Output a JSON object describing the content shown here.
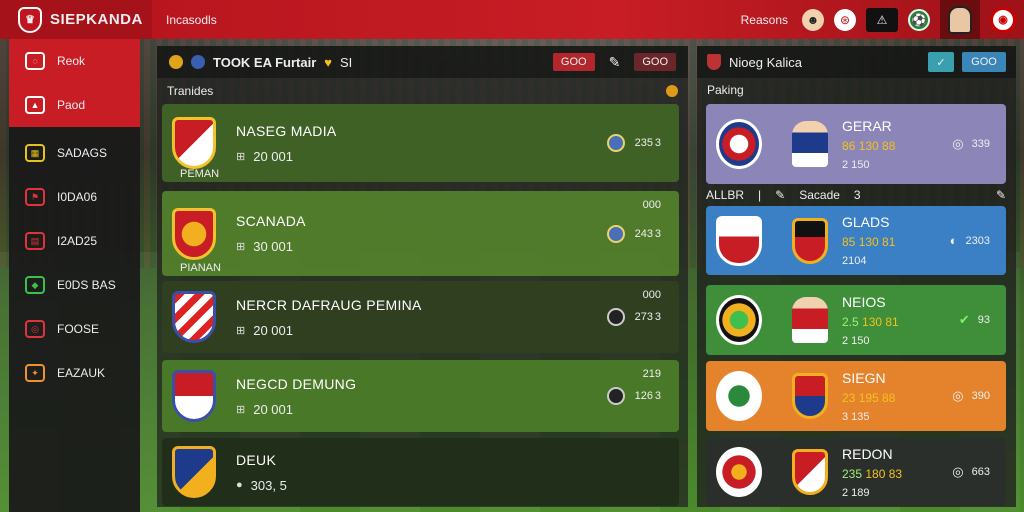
{
  "app": {
    "title": "SIEPKANDA",
    "link": "Incasodls"
  },
  "top_right": {
    "label": "Reasons"
  },
  "sidebar": {
    "items": [
      {
        "label": "Reok",
        "icon": "chat-bubble-icon",
        "active": true
      },
      {
        "label": "Paod",
        "icon": "bookmark-icon",
        "active": true
      },
      {
        "label": "SADAGS",
        "icon": "grid-icon",
        "active": false
      },
      {
        "label": "I0DA06",
        "icon": "flag-icon",
        "active": false
      },
      {
        "label": "I2AD25",
        "icon": "calendar-icon",
        "active": false
      },
      {
        "label": "E0DS BAS",
        "icon": "tag-icon",
        "active": false
      },
      {
        "label": "FOOSE",
        "icon": "ball-icon",
        "active": false
      },
      {
        "label": "EAZAUK",
        "icon": "star-icon",
        "active": false
      }
    ]
  },
  "center": {
    "header_title": "TOOK EA Furtair",
    "header_suffix": "SI",
    "btn1": "GOO",
    "btn2": "GOO",
    "section_label": "Tranides",
    "cards": [
      {
        "name": "NASEG MADIA",
        "sub": "20 001",
        "label": "PEMAN",
        "score": "235",
        "count": "3",
        "top": ""
      },
      {
        "name": "SCANADA",
        "sub": "30 001",
        "label": "PIANAN",
        "score": "243",
        "count": "3",
        "top": "000"
      },
      {
        "name": "NERCR DAFRAUG PEMINA",
        "sub": "20 001",
        "label": "",
        "score": "273",
        "count": "3",
        "top": "000"
      },
      {
        "name": "NEGCD DEMUNG",
        "sub": "20 001",
        "label": "",
        "score": "126",
        "count": "3",
        "top": "219"
      },
      {
        "name": "DEUK",
        "sub": "303, 5",
        "label": "",
        "score": "",
        "count": "",
        "top": ""
      }
    ]
  },
  "right": {
    "header_title": "Nioeg Kalica",
    "btn_b": "GOO",
    "section_label": "Paking",
    "filter": {
      "a": "ALLBR",
      "b": "Sacade",
      "c": "3"
    },
    "cards": [
      {
        "name": "GERAR",
        "stat1": "86",
        "stat2": "130 88",
        "sub": "2 150",
        "right": "339",
        "color": "#8b85b8"
      },
      {
        "name": "GLADS",
        "stat1": "85",
        "stat2": "130 81",
        "sub": "2104",
        "right": "2303",
        "color": "#3b7fc4"
      },
      {
        "name": "NEIOS",
        "stat1": "2.5",
        "stat2": "130 81",
        "sub": "2 150",
        "right": "93",
        "color": "#3f8e3a"
      },
      {
        "name": "SIEGN",
        "stat1": "23",
        "stat2": "195 88",
        "sub": "3 135",
        "right": "390",
        "color": "#e5832c"
      },
      {
        "name": "REDON",
        "stat1": "235",
        "stat2": "180 83",
        "sub": "2 189",
        "right": "663",
        "color": "#2b2f2b"
      }
    ]
  }
}
